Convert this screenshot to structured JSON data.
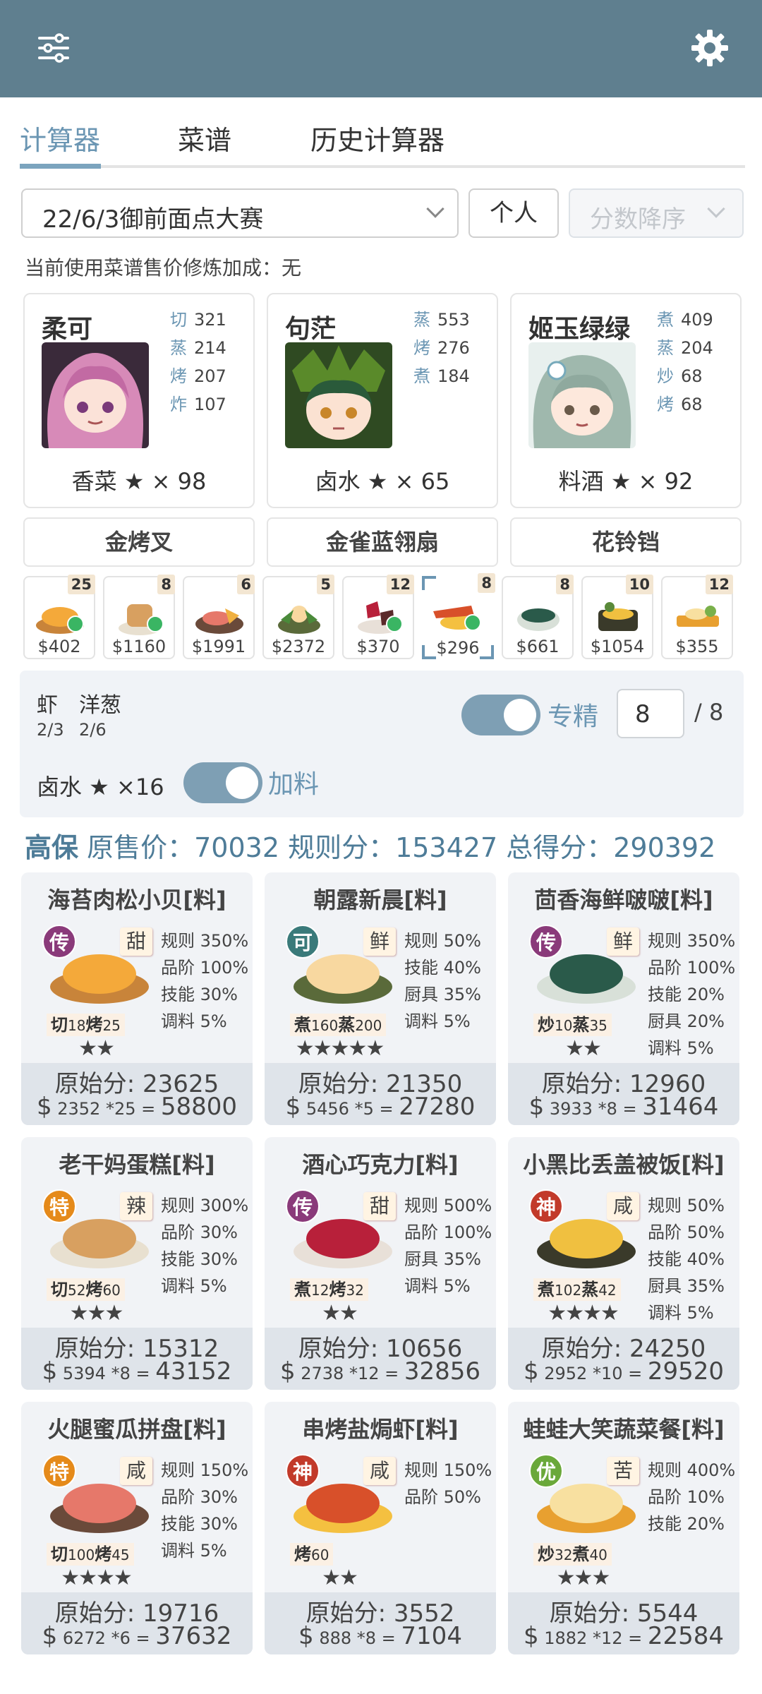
{
  "colors": {
    "topbar": "#5f7f8f",
    "accent": "#6b96b3"
  },
  "tabs": [
    {
      "label": "计算器"
    },
    {
      "label": "菜谱"
    },
    {
      "label": "历史计算器"
    }
  ],
  "filters": {
    "contest": "22/6/3御前面点大赛",
    "mode": "个人",
    "sort": "分数降序"
  },
  "hint": "当前使用菜谱售价修炼加成：无",
  "chefs": [
    {
      "name": "柔可",
      "skills": [
        {
          "k": "切",
          "v": "321"
        },
        {
          "k": "蒸",
          "v": "214"
        },
        {
          "k": "烤",
          "v": "207"
        },
        {
          "k": "炸",
          "v": "107"
        }
      ],
      "cond": "香菜 ★ × 98"
    },
    {
      "name": "句茫",
      "skills": [
        {
          "k": "蒸",
          "v": "553"
        },
        {
          "k": "烤",
          "v": "276"
        },
        {
          "k": "煮",
          "v": "184"
        }
      ],
      "cond": "卤水 ★ × 65"
    },
    {
      "name": "姬玉绿绿",
      "skills": [
        {
          "k": "煮",
          "v": "409"
        },
        {
          "k": "蒸",
          "v": "204"
        },
        {
          "k": "炒",
          "v": "68"
        },
        {
          "k": "烤",
          "v": "68"
        }
      ],
      "cond": "料酒 ★ × 92"
    }
  ],
  "equips": [
    "金烤叉",
    "金雀蓝翎扇",
    "花铃铛"
  ],
  "slots": [
    {
      "price": "$402",
      "qty": "25"
    },
    {
      "price": "$1160",
      "qty": "8"
    },
    {
      "price": "$1991",
      "qty": "6"
    },
    {
      "price": "$2372",
      "qty": "5"
    },
    {
      "price": "$370",
      "qty": "12"
    },
    {
      "price": "$296",
      "qty": "8"
    },
    {
      "price": "$661",
      "qty": "8"
    },
    {
      "price": "$1054",
      "qty": "10"
    },
    {
      "price": "$355",
      "qty": "12"
    }
  ],
  "panel": {
    "ing1": "虾",
    "ing2": "洋葱",
    "frac1": "2/3",
    "frac2": "2/6",
    "spec_label": "专精",
    "count": "8",
    "max": "/ 8",
    "sauce": "卤水 ★ ×16",
    "add_label": "加料"
  },
  "summary": {
    "label": "高保",
    "text": "原售价：70032 规则分：153427 总得分：290392"
  },
  "cards": [
    {
      "title": "海苔肉松小贝[料]",
      "rarity": "传",
      "flavor": "甜",
      "rules": [
        "规则 350%",
        "品阶 100%",
        "技能 30%",
        "调料 5%"
      ],
      "sk1": "切",
      "n1": "18",
      "sk2": "烤",
      "n2": "25",
      "stars": "★★",
      "raw": "原始分: 23625",
      "unit": "2352",
      "mul": "*25",
      "total": "58800"
    },
    {
      "title": "朝露新晨[料]",
      "rarity": "可",
      "flavor": "鲜",
      "rules": [
        "规则 50%",
        "技能 40%",
        "厨具 35%",
        "调料 5%"
      ],
      "sk1": "煮",
      "n1": "160",
      "sk2": "蒸",
      "n2": "200",
      "stars": "★★★★★",
      "raw": "原始分: 21350",
      "unit": "5456",
      "mul": "*5",
      "total": "27280"
    },
    {
      "title": "茴香海鲜啵啵[料]",
      "rarity": "传",
      "flavor": "鲜",
      "rules": [
        "规则 350%",
        "品阶 100%",
        "技能 20%",
        "厨具 20%",
        "调料 5%"
      ],
      "sk1": "炒",
      "n1": "10",
      "sk2": "蒸",
      "n2": "35",
      "stars": "★★",
      "raw": "原始分: 12960",
      "unit": "3933",
      "mul": "*8",
      "total": "31464"
    },
    {
      "title": "老干妈蛋糕[料]",
      "rarity": "特",
      "flavor": "辣",
      "rules": [
        "规则 300%",
        "品阶 30%",
        "技能 30%",
        "调料 5%"
      ],
      "sk1": "切",
      "n1": "52",
      "sk2": "烤",
      "n2": "60",
      "stars": "★★★",
      "raw": "原始分: 15312",
      "unit": "5394",
      "mul": "*8",
      "total": "43152"
    },
    {
      "title": "酒心巧克力[料]",
      "rarity": "传",
      "flavor": "甜",
      "rules": [
        "规则 500%",
        "品阶 100%",
        "厨具 35%",
        "调料 5%"
      ],
      "sk1": "煮",
      "n1": "12",
      "sk2": "烤",
      "n2": "32",
      "stars": "★★",
      "raw": "原始分: 10656",
      "unit": "2738",
      "mul": "*12",
      "total": "32856"
    },
    {
      "title": "小黑比丢盖被饭[料]",
      "rarity": "神",
      "flavor": "咸",
      "rules": [
        "规则 50%",
        "品阶 50%",
        "技能 40%",
        "厨具 35%",
        "调料 5%"
      ],
      "sk1": "煮",
      "n1": "102",
      "sk2": "蒸",
      "n2": "42",
      "stars": "★★★★",
      "raw": "原始分: 24250",
      "unit": "2952",
      "mul": "*10",
      "total": "29520"
    },
    {
      "title": "火腿蜜瓜拼盘[料]",
      "rarity": "特",
      "flavor": "咸",
      "rules": [
        "规则 150%",
        "品阶 30%",
        "技能 30%",
        "调料 5%"
      ],
      "sk1": "切",
      "n1": "100",
      "sk2": "烤",
      "n2": "45",
      "stars": "★★★★",
      "raw": "原始分: 19716",
      "unit": "6272",
      "mul": "*6",
      "total": "37632"
    },
    {
      "title": "串烤盐焗虾[料]",
      "rarity": "神",
      "flavor": "咸",
      "rules": [
        "规则 150%",
        "品阶 50%"
      ],
      "sk1": "烤",
      "n1": "60",
      "sk2": "",
      "n2": "",
      "stars": "★★",
      "raw": "原始分: 3552",
      "unit": "888",
      "mul": "*8",
      "total": "7104"
    },
    {
      "title": "蛙蛙大笑蔬菜餐[料]",
      "rarity": "优",
      "flavor": "苦",
      "rules": [
        "规则 400%",
        "品阶 10%",
        "技能 20%"
      ],
      "sk1": "炒",
      "n1": "32",
      "sk2": "煮",
      "n2": "40",
      "stars": "★★★",
      "raw": "原始分: 5544",
      "unit": "1882",
      "mul": "*12",
      "total": "22584"
    }
  ]
}
